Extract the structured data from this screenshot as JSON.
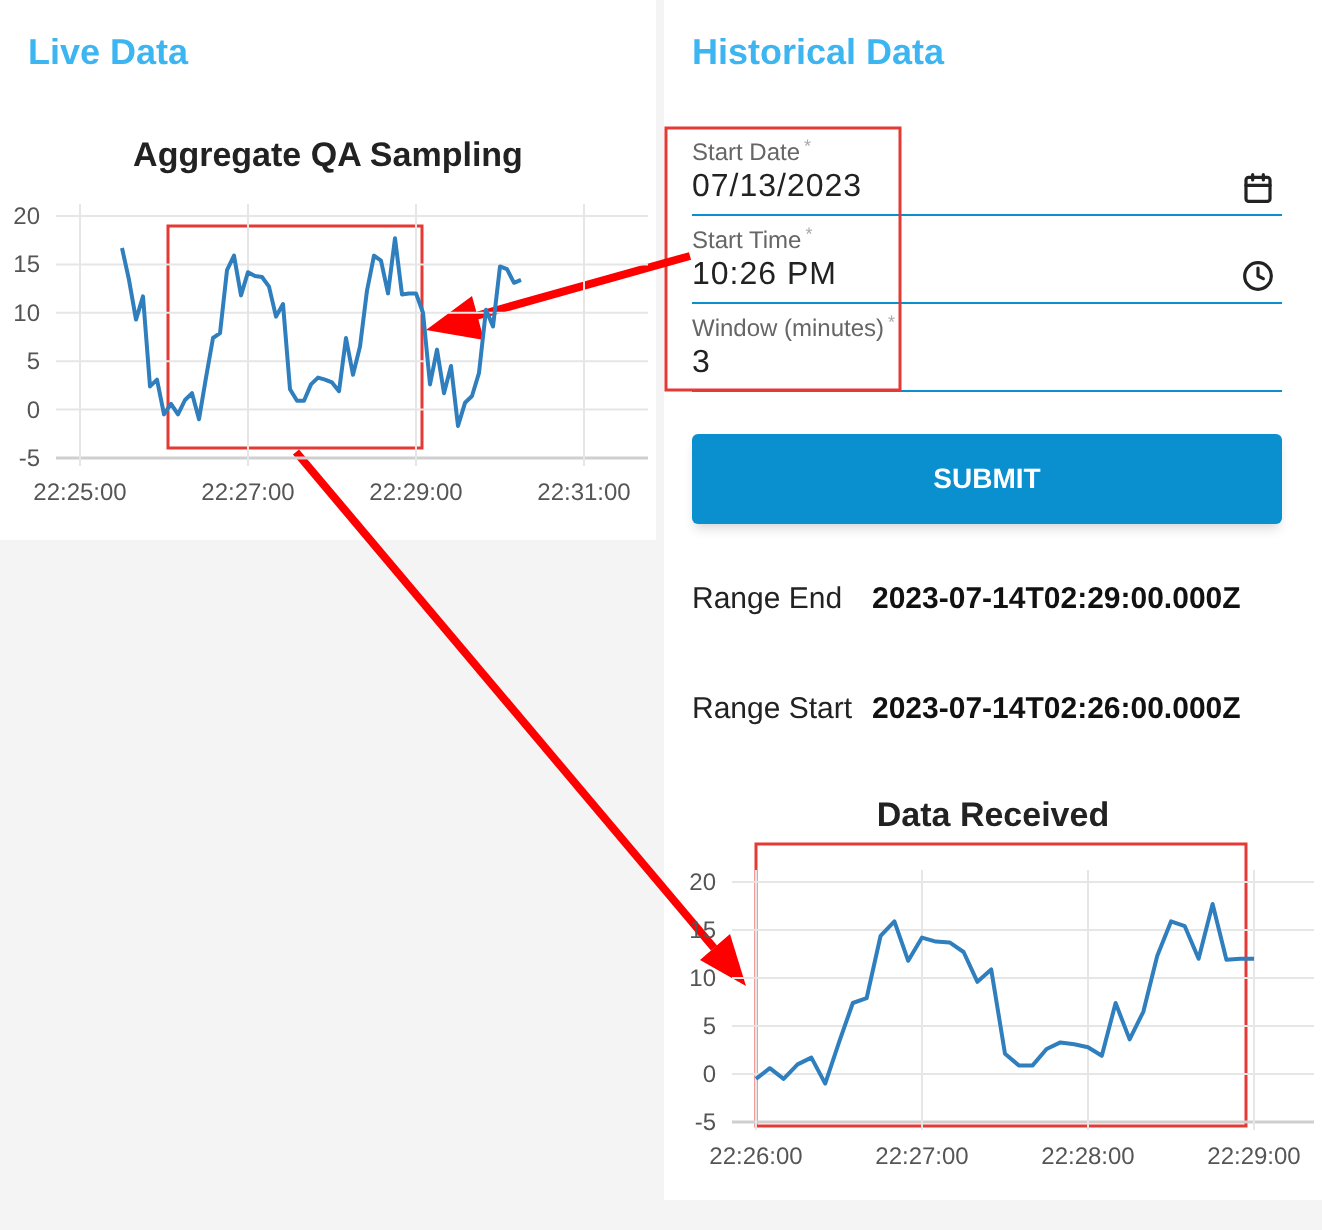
{
  "live_panel": {
    "title": "Live Data",
    "chart_data": {
      "type": "line",
      "title": "Aggregate QA Sampling",
      "categories": [
        "22:25:00",
        null,
        null,
        null,
        null,
        null,
        null,
        null,
        null,
        null,
        null,
        null,
        null,
        null,
        null,
        null,
        null,
        null,
        null,
        null,
        null,
        null,
        null,
        null,
        "22:27:00",
        null,
        null,
        null,
        null,
        null,
        null,
        null,
        null,
        null,
        null,
        null,
        null,
        null,
        null,
        null,
        null,
        null,
        null,
        null,
        null,
        null,
        null,
        null,
        "22:29:00",
        null,
        null,
        null,
        null,
        null,
        null,
        null,
        null,
        null,
        null,
        null,
        null,
        null,
        null,
        null,
        null,
        null,
        null,
        null,
        null,
        null,
        null,
        null,
        "22:31:00"
      ],
      "grid": true,
      "series": [
        {
          "color": "#2f7ebd",
          "values": [
            null,
            null,
            null,
            null,
            null,
            null,
            16.7,
            13.4,
            9.3,
            11.7,
            2.4,
            3.1,
            -0.5,
            0.6,
            -0.5,
            1.0,
            1.7,
            -1.0,
            3.3,
            7.4,
            7.9,
            14.4,
            15.9,
            11.8,
            14.2,
            13.8,
            13.7,
            12.7,
            9.6,
            10.9,
            2.1,
            0.9,
            0.9,
            2.6,
            3.3,
            3.1,
            2.8,
            1.9,
            7.4,
            3.6,
            6.5,
            12.3,
            15.9,
            15.4,
            12.0,
            17.7,
            11.9,
            12.0,
            12.0,
            10.0,
            2.6,
            6.2,
            1.7,
            4.5,
            -1.7,
            0.7,
            1.4,
            3.8,
            10.3,
            8.6,
            14.8,
            14.5,
            13.1,
            13.4,
            null,
            null,
            null,
            null,
            null,
            null,
            null,
            null,
            null
          ]
        }
      ],
      "ylim": [
        -5,
        20
      ],
      "yticks": [
        20,
        15,
        10,
        5,
        0,
        -5
      ]
    }
  },
  "historical_panel": {
    "title": "Historical Data",
    "fields": [
      {
        "kind": "date",
        "label": "Start Date",
        "required_mark": "*",
        "value": "07/13/2023"
      },
      {
        "kind": "time",
        "label": "Start Time",
        "required_mark": "*",
        "value": "10:26 PM"
      },
      {
        "kind": "number",
        "label": "Window (minutes)",
        "required_mark": "*",
        "value": "3"
      }
    ],
    "submit": "SUBMIT",
    "ranges": [
      {
        "label": "Range End",
        "value": "2023-07-14T02:29:00.000Z"
      },
      {
        "label": "Range Start",
        "value": "2023-07-14T02:26:00.000Z"
      }
    ],
    "chart_data": {
      "type": "line",
      "title": "Data Received",
      "categories": [
        "22:26:00",
        null,
        null,
        null,
        null,
        null,
        null,
        null,
        null,
        null,
        null,
        null,
        "22:27:00",
        null,
        null,
        null,
        null,
        null,
        null,
        null,
        null,
        null,
        null,
        null,
        "22:28:00",
        null,
        null,
        null,
        null,
        null,
        null,
        null,
        null,
        null,
        null,
        null,
        "22:29:00"
      ],
      "grid": true,
      "series": [
        {
          "color": "#2f7ebd",
          "values": [
            -0.5,
            0.6,
            -0.5,
            1.0,
            1.7,
            -1.0,
            3.3,
            7.4,
            7.9,
            14.4,
            15.9,
            11.8,
            14.2,
            13.8,
            13.7,
            12.7,
            9.6,
            10.9,
            2.1,
            0.9,
            0.9,
            2.6,
            3.3,
            3.1,
            2.8,
            1.9,
            7.4,
            3.6,
            6.5,
            12.3,
            15.9,
            15.4,
            12.0,
            17.7,
            11.9,
            12.0,
            12.0
          ]
        }
      ],
      "ylim": [
        -5,
        20
      ],
      "yticks": [
        20,
        15,
        10,
        5,
        0,
        -5
      ]
    }
  }
}
